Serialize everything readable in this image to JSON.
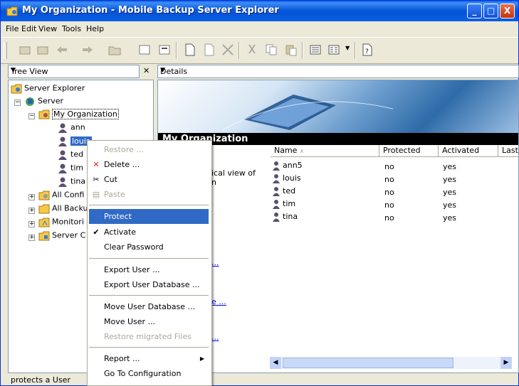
{
  "window": {
    "title": "My Organization - Mobile Backup  Server Explorer",
    "buttons": {
      "min": "_",
      "max": "□",
      "close": "X"
    }
  },
  "menubar": [
    "File",
    "Edit",
    "View",
    "Tools",
    "Help"
  ],
  "toolbar": {
    "icons": [
      "up-folder-icon",
      "properties-icon",
      "back-icon",
      "forward-icon",
      "folder-icon",
      "refresh-icon",
      "connect-icon",
      "new-icon",
      "edit-icon",
      "delete-icon",
      "cut-icon",
      "copy-icon",
      "paste-icon",
      "list-view-icon",
      "details-view-icon",
      "help-icon"
    ]
  },
  "tree_pane": {
    "title": "Tree View",
    "items": [
      {
        "label": "Server Explorer"
      },
      {
        "label": "Server"
      },
      {
        "label": "My Organization"
      },
      {
        "label": "ann"
      },
      {
        "label": "louis"
      },
      {
        "label": "ted"
      },
      {
        "label": "tim"
      },
      {
        "label": "tina"
      },
      {
        "label": "All Confi"
      },
      {
        "label": "All Backu"
      },
      {
        "label": "Monitori"
      },
      {
        "label": "Server C"
      }
    ]
  },
  "details_pane": {
    "title": "Details",
    "banner_title": "My Organization",
    "side_text": [
      "ical view of",
      "n"
    ],
    "columns": [
      "Name",
      "Protected",
      "Activated",
      "Last"
    ],
    "rows": [
      {
        "name": "ann5",
        "protected": "no",
        "activated": "yes"
      },
      {
        "name": "louis",
        "protected": "no",
        "activated": "yes"
      },
      {
        "name": "ted",
        "protected": "no",
        "activated": "yes"
      },
      {
        "name": "tim",
        "protected": "no",
        "activated": "yes"
      },
      {
        "name": "tina",
        "protected": "no",
        "activated": "yes"
      }
    ],
    "links": [
      "...",
      "e ...",
      "..."
    ]
  },
  "context_menu": {
    "items": [
      {
        "label": "Restore ...",
        "disabled": true
      },
      {
        "label": "Delete ..."
      },
      {
        "label": "Cut"
      },
      {
        "label": "Paste",
        "disabled": true
      },
      {
        "label": "Protect",
        "highlighted": true
      },
      {
        "label": "Activate",
        "checked": true
      },
      {
        "label": "Clear Password"
      },
      {
        "label": "Export User ..."
      },
      {
        "label": "Export User Database ..."
      },
      {
        "label": "Move User Database ..."
      },
      {
        "label": "Move User ..."
      },
      {
        "label": "Restore migrated Files",
        "disabled": true
      },
      {
        "label": "Report ..."
      },
      {
        "label": "Go To Configuration"
      }
    ]
  },
  "status": {
    "text": "protects a User"
  },
  "colors": {
    "titlebar": "#0A5EE8",
    "highlight": "#316AC5",
    "menu_bg": "#ECE9D8"
  }
}
